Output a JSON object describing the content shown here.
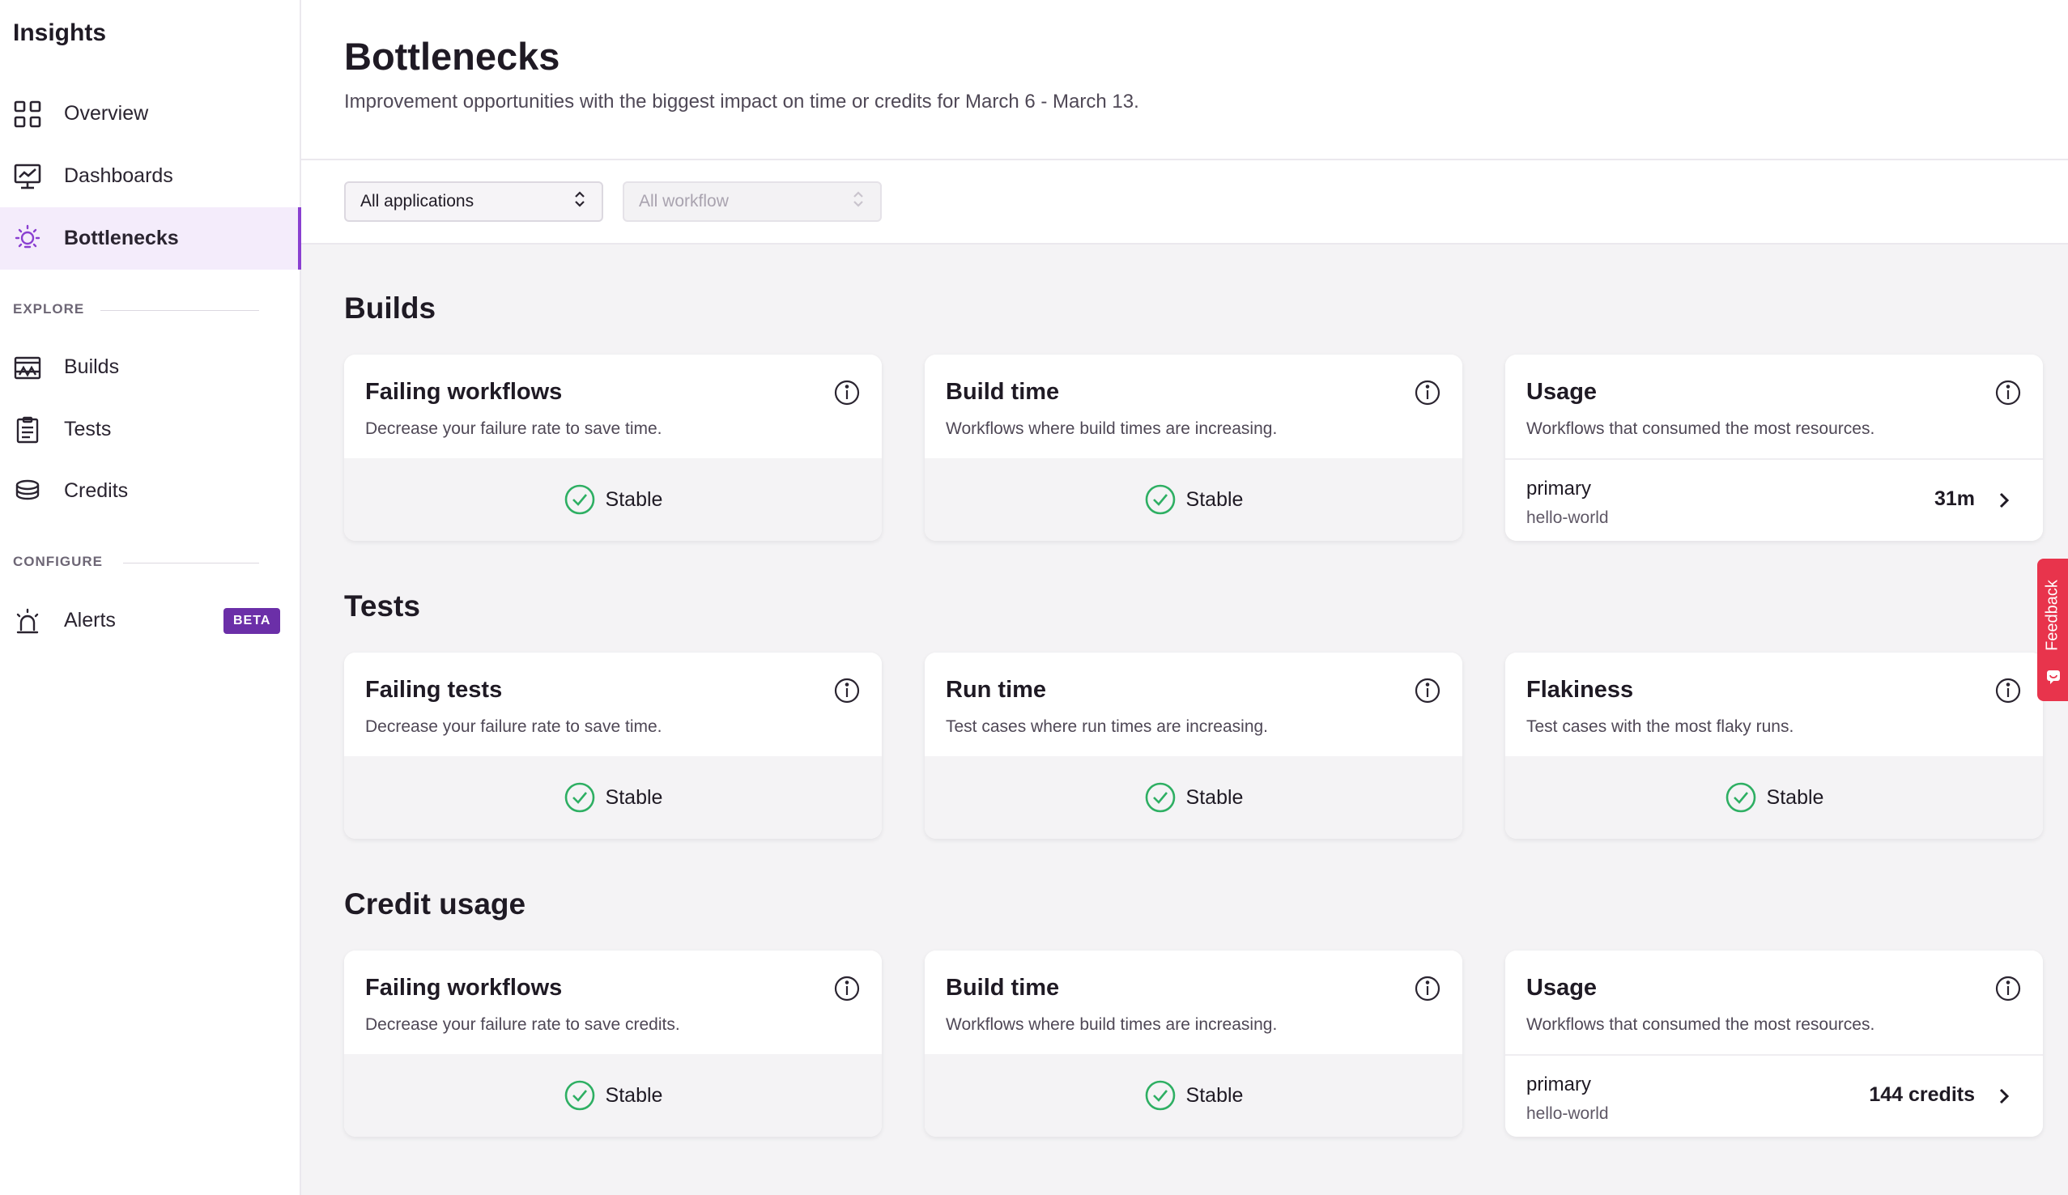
{
  "sidebar": {
    "app_title": "Insights",
    "nav": [
      {
        "label": "Overview",
        "icon": "grid-icon"
      },
      {
        "label": "Dashboards",
        "icon": "dashboard-chart-icon"
      },
      {
        "label": "Bottlenecks",
        "icon": "bulb-icon",
        "active": true
      }
    ],
    "explore_label": "EXPLORE",
    "explore": [
      {
        "label": "Builds",
        "icon": "builds-icon"
      },
      {
        "label": "Tests",
        "icon": "clipboard-icon"
      },
      {
        "label": "Credits",
        "icon": "coins-stack-icon"
      }
    ],
    "configure_label": "CONFIGURE",
    "configure": [
      {
        "label": "Alerts",
        "icon": "siren-icon",
        "badge": "BETA"
      }
    ]
  },
  "header": {
    "title": "Bottlenecks",
    "subtitle": "Improvement opportunities with the biggest impact on time or credits for March 6 - March 13."
  },
  "filters": {
    "applications": "All applications",
    "workflow": "All workflow"
  },
  "groups": [
    {
      "title": "Builds",
      "cards": [
        {
          "title": "Failing workflows",
          "desc": "Decrease your failure rate to save time.",
          "status": "Stable"
        },
        {
          "title": "Build time",
          "desc": "Workflows where build times are increasing.",
          "status": "Stable"
        },
        {
          "title": "Usage",
          "desc": "Workflows that consumed the most resources.",
          "workflow": "primary",
          "app": "hello-world",
          "value": "31m"
        }
      ]
    },
    {
      "title": "Tests",
      "cards": [
        {
          "title": "Failing tests",
          "desc": "Decrease your failure rate to save time.",
          "status": "Stable"
        },
        {
          "title": "Run time",
          "desc": "Test cases where run times are increasing.",
          "status": "Stable"
        },
        {
          "title": "Flakiness",
          "desc": "Test cases with the most flaky runs.",
          "status": "Stable"
        }
      ]
    },
    {
      "title": "Credit usage",
      "cards": [
        {
          "title": "Failing workflows",
          "desc": "Decrease your failure rate to save credits.",
          "status": "Stable"
        },
        {
          "title": "Build time",
          "desc": "Workflows where build times are increasing.",
          "status": "Stable"
        },
        {
          "title": "Usage",
          "desc": "Workflows that consumed the most resources.",
          "workflow": "primary",
          "app": "hello-world",
          "value": "144 credits"
        }
      ]
    }
  ],
  "feedback_label": "Feedback",
  "colors": {
    "accent": "#8a3fd1",
    "beta_badge": "#6b2fa8",
    "stable_green": "#2eaf63",
    "feedback_red": "#e8344c"
  }
}
